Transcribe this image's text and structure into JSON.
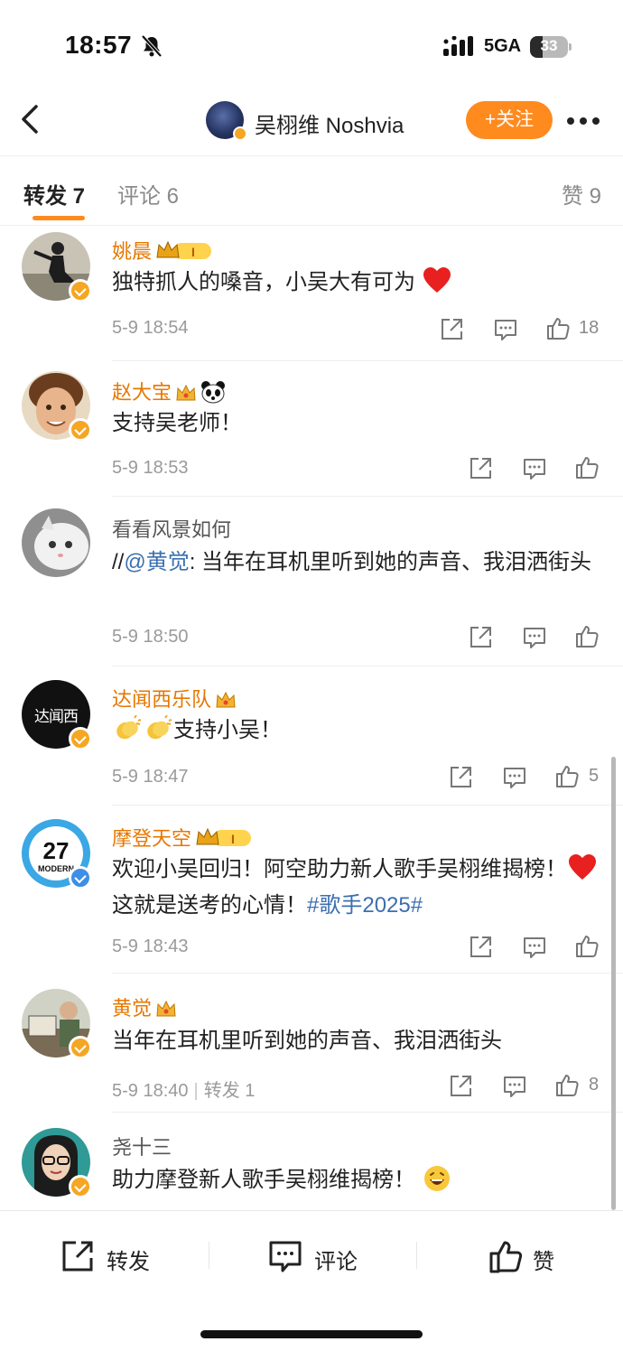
{
  "status_bar": {
    "time": "18:57",
    "network": "5GA",
    "battery": "33",
    "battery_level": 0.33
  },
  "header": {
    "title": "吴栩维 Noshvia",
    "follow_label": "+关注"
  },
  "tabs": {
    "repost": "转发 7",
    "comment": "评论 6",
    "like": "赞 9"
  },
  "comments": [
    {
      "user": "姚晨",
      "text": "独特抓人的嗓音，小吴大有可为",
      "time": "5-9 18:54",
      "likes": "18",
      "avatar_color": "#b9b2a3"
    },
    {
      "user": "赵大宝",
      "text": "支持吴老师！",
      "time": "5-9 18:53",
      "likes": "",
      "avatar_color": "#a66a3e"
    },
    {
      "user": "看看风景如何",
      "prefix": "//",
      "mention": "@黄觉",
      "text": ": 当年在耳机里听到她的声音、我泪洒街头",
      "time": "5-9 18:50",
      "likes": "",
      "avatar_color": "#9b9b9b"
    },
    {
      "user": "达闻西乐队",
      "text": "支持小吴！",
      "avatar_text": "达闻西",
      "time": "5-9 18:47",
      "likes": "5",
      "avatar_color": "#111111"
    },
    {
      "user": "摩登天空",
      "text_a": "欢迎小吴回归！阿空助力新人歌手吴栩维揭榜！",
      "text_b": "这就是送考的心情！",
      "hashtag": "#歌手2025#",
      "avatar_text_a": "27",
      "avatar_text_b": "MODERN",
      "time": "5-9 18:43",
      "likes": "",
      "avatar_color": "#36a3e0"
    },
    {
      "user": "黄觉",
      "text": "当年在耳机里听到她的声音、我泪洒街头",
      "time": "5-9 18:40",
      "repost": "转发 1",
      "likes": "8",
      "avatar_color": "#7d8a72"
    },
    {
      "user": "尧十三",
      "text": "助力摩登新人歌手吴栩维揭榜！",
      "avatar_color": "#2b8a8a"
    }
  ],
  "bottom_bar": {
    "repost": "转发",
    "comment": "评论",
    "like": "赞"
  },
  "colors": {
    "accent": "#ff8a1e",
    "link": "#3b6fb0",
    "gold_name": "#e67700"
  }
}
